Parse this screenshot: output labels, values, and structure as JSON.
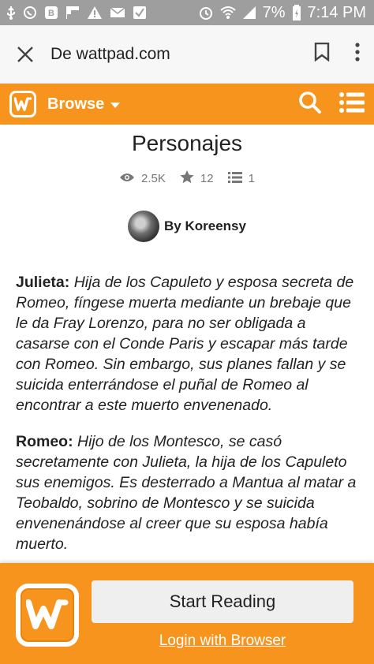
{
  "status_bar": {
    "battery": "7%",
    "time": "7:14 PM"
  },
  "browser": {
    "title": "De wattpad.com"
  },
  "header": {
    "browse_label": "Browse"
  },
  "story": {
    "title": "Personajes",
    "stats": {
      "views": "2.5K",
      "votes": "12",
      "parts": "1"
    },
    "author": "By Koreensy",
    "paragraphs": [
      {
        "name": "Julieta:",
        "text": "Hija de los Capuleto y esposa secreta de Romeo, fíngese muerta mediante un brebaje que le da Fray Lorenzo, para no ser obligada a casarse con el Conde Paris y escapar más tarde con Romeo. Sin embargo, sus planes fallan y se suicida enterrándose el puñal de Romeo al encontrar a este muerto envenenado."
      },
      {
        "name": "Romeo:",
        "text": "Hijo de los Montesco, se casó secretamente con Julieta, la hija de los Capuleto sus enemigos. Es desterrado a Mantua al matar a Teobaldo, sobrino de Montesco y se suicida envenenándose al creer que su esposa había muerto."
      }
    ]
  },
  "bottom": {
    "start_label": "Start Reading",
    "login_label": "Login with Browser"
  },
  "colors": {
    "brand_orange": "#f7941d",
    "status_gray": "#9e9e9e"
  }
}
